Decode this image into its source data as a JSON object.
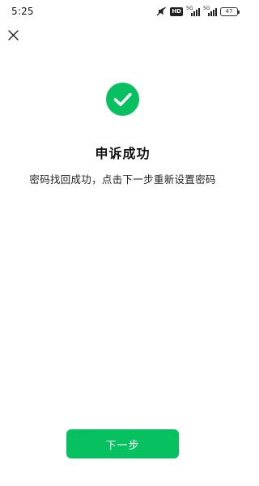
{
  "status_bar": {
    "time": "5:25",
    "hd_label": "HD",
    "signal1_label": "5G",
    "signal2_label": "5G",
    "battery_level": "47",
    "icons": [
      "mute-icon",
      "hd-icon",
      "signal-icon",
      "signal-icon",
      "battery-icon"
    ]
  },
  "header": {
    "close_icon": "close-icon"
  },
  "result": {
    "icon": "success-check-icon",
    "title": "申诉成功",
    "description": "密码找回成功，点击下一步重新设置密码"
  },
  "actions": {
    "next_label": "下一步"
  },
  "colors": {
    "accent": "#07c160",
    "text_primary": "#111111",
    "background": "#ffffff"
  }
}
